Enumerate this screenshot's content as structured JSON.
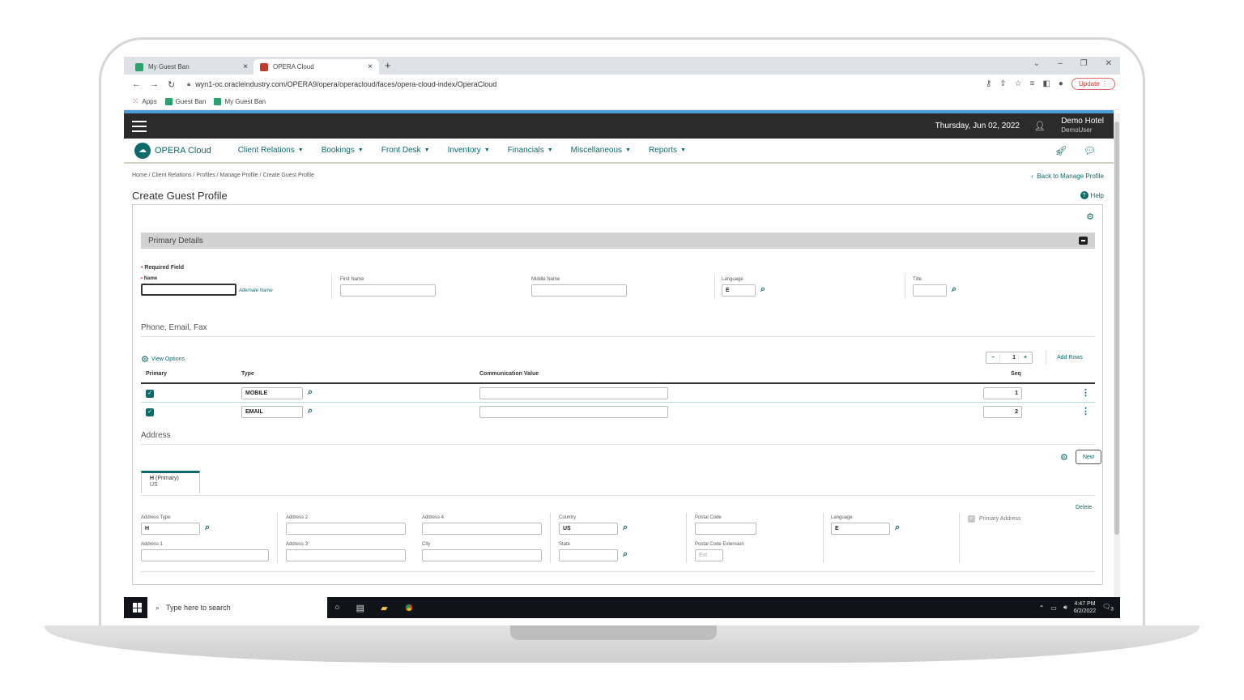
{
  "browser": {
    "tabs": [
      {
        "title": "My Guest Ban",
        "close": "×"
      },
      {
        "title": "OPERA Cloud",
        "close": "×"
      }
    ],
    "new_tab": "+",
    "window_controls": [
      "⌄",
      "–",
      "❐",
      "✕"
    ],
    "url": "wyn1-oc.oracleindustry.com/OPERA9/opera/operacloud/faces/opera-cloud-index/OperaCloud",
    "update_label": "Update",
    "bookmarks": [
      "Apps",
      "Guest Ban",
      "My Guest Ban"
    ]
  },
  "header": {
    "date": "Thursday, Jun 02, 2022",
    "hotel": "Demo Hotel",
    "user": "DemoUser"
  },
  "nav": {
    "logo": "OPERA Cloud",
    "menu": [
      "Client Relations",
      "Bookings",
      "Front Desk",
      "Inventory",
      "Financials",
      "Miscellaneous",
      "Reports"
    ]
  },
  "page": {
    "breadcrumb": "Home / Client Relations / Profiles / Manage Profile / Create Guest Profile",
    "back_link": "Back to Manage Profile",
    "title": "Create Guest Profile",
    "help": "Help"
  },
  "primary_details": {
    "section_title": "Primary Details",
    "required_note": "Required Field",
    "name_label": "Name",
    "alternate_name": "Alternate Name",
    "first_name_label": "First Name",
    "middle_name_label": "Middle Name",
    "language_label": "Language",
    "language_value": "E",
    "title_label": "Title"
  },
  "communication": {
    "section_title": "Phone, Email, Fax",
    "view_options": "View Options",
    "rows_count": "1",
    "add_rows": "Add Rows",
    "columns": [
      "Primary",
      "Type",
      "Communication Value",
      "Seq"
    ],
    "rows": [
      {
        "type": "MOBILE",
        "value": "",
        "seq": "1"
      },
      {
        "type": "EMAIL",
        "value": "",
        "seq": "2"
      }
    ]
  },
  "address": {
    "section_title": "Address",
    "new_label": "New",
    "tab_label": "H",
    "tab_primary": "(Primary)",
    "tab_country": "US",
    "delete": "Delete",
    "address_type_label": "Address Type",
    "address_type_value": "H",
    "address1_label": "Address 1",
    "address2_label": "Address 2",
    "address3_label": "Address 3",
    "address4_label": "Address 4",
    "city_label": "City",
    "country_label": "Country",
    "country_value": "US",
    "state_label": "State",
    "postal_code_label": "Postal Code",
    "postal_ext_label": "Postal Code Extension",
    "postal_ext_placeholder": "Ext",
    "language_label": "Language",
    "language_value": "E",
    "primary_address": "Primary Address"
  },
  "taskbar": {
    "search_placeholder": "Type here to search",
    "time": "4:47 PM",
    "date": "6/2/2022",
    "notifications": "3"
  },
  "colors": {
    "brand_teal": "#0d6a6a",
    "header_dark": "#2b2b2b",
    "accent_blue": "#4a9dd6"
  }
}
